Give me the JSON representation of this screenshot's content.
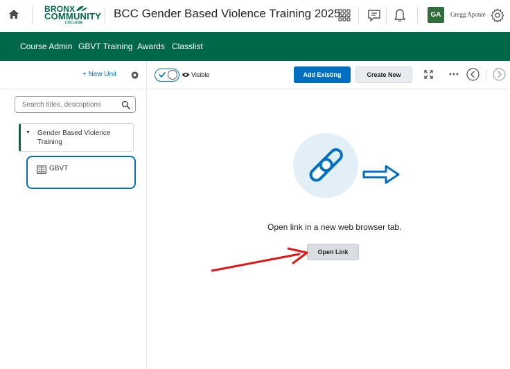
{
  "header": {
    "logo": {
      "line1": "BRONX",
      "line2": "COMMUNITY",
      "line3": "COLLEGE"
    },
    "course_title": "BCC Gender Based Violence Training 2025...",
    "user": {
      "initials": "GA",
      "name": "Gregg Aponte"
    }
  },
  "nav": {
    "items": [
      "Course Admin",
      "GBVT Training",
      "Awards",
      "Classlist"
    ]
  },
  "sidebar": {
    "new_unit_label": "+ New Unit",
    "search_placeholder": "Search titles, descriptions",
    "unit": {
      "label": "Gender Based Violence Training"
    },
    "lesson": {
      "label": "GBVT"
    }
  },
  "toolbar": {
    "visibility_label": "Visible",
    "add_existing_label": "Add Existing",
    "create_new_label": "Create New",
    "more_label": "..."
  },
  "content": {
    "message": "Open link in a new web browser tab.",
    "open_link_label": "Open Link"
  },
  "colors": {
    "brand_green": "#00684a",
    "primary_blue": "#006fbf",
    "annotation_red": "#e01616"
  }
}
